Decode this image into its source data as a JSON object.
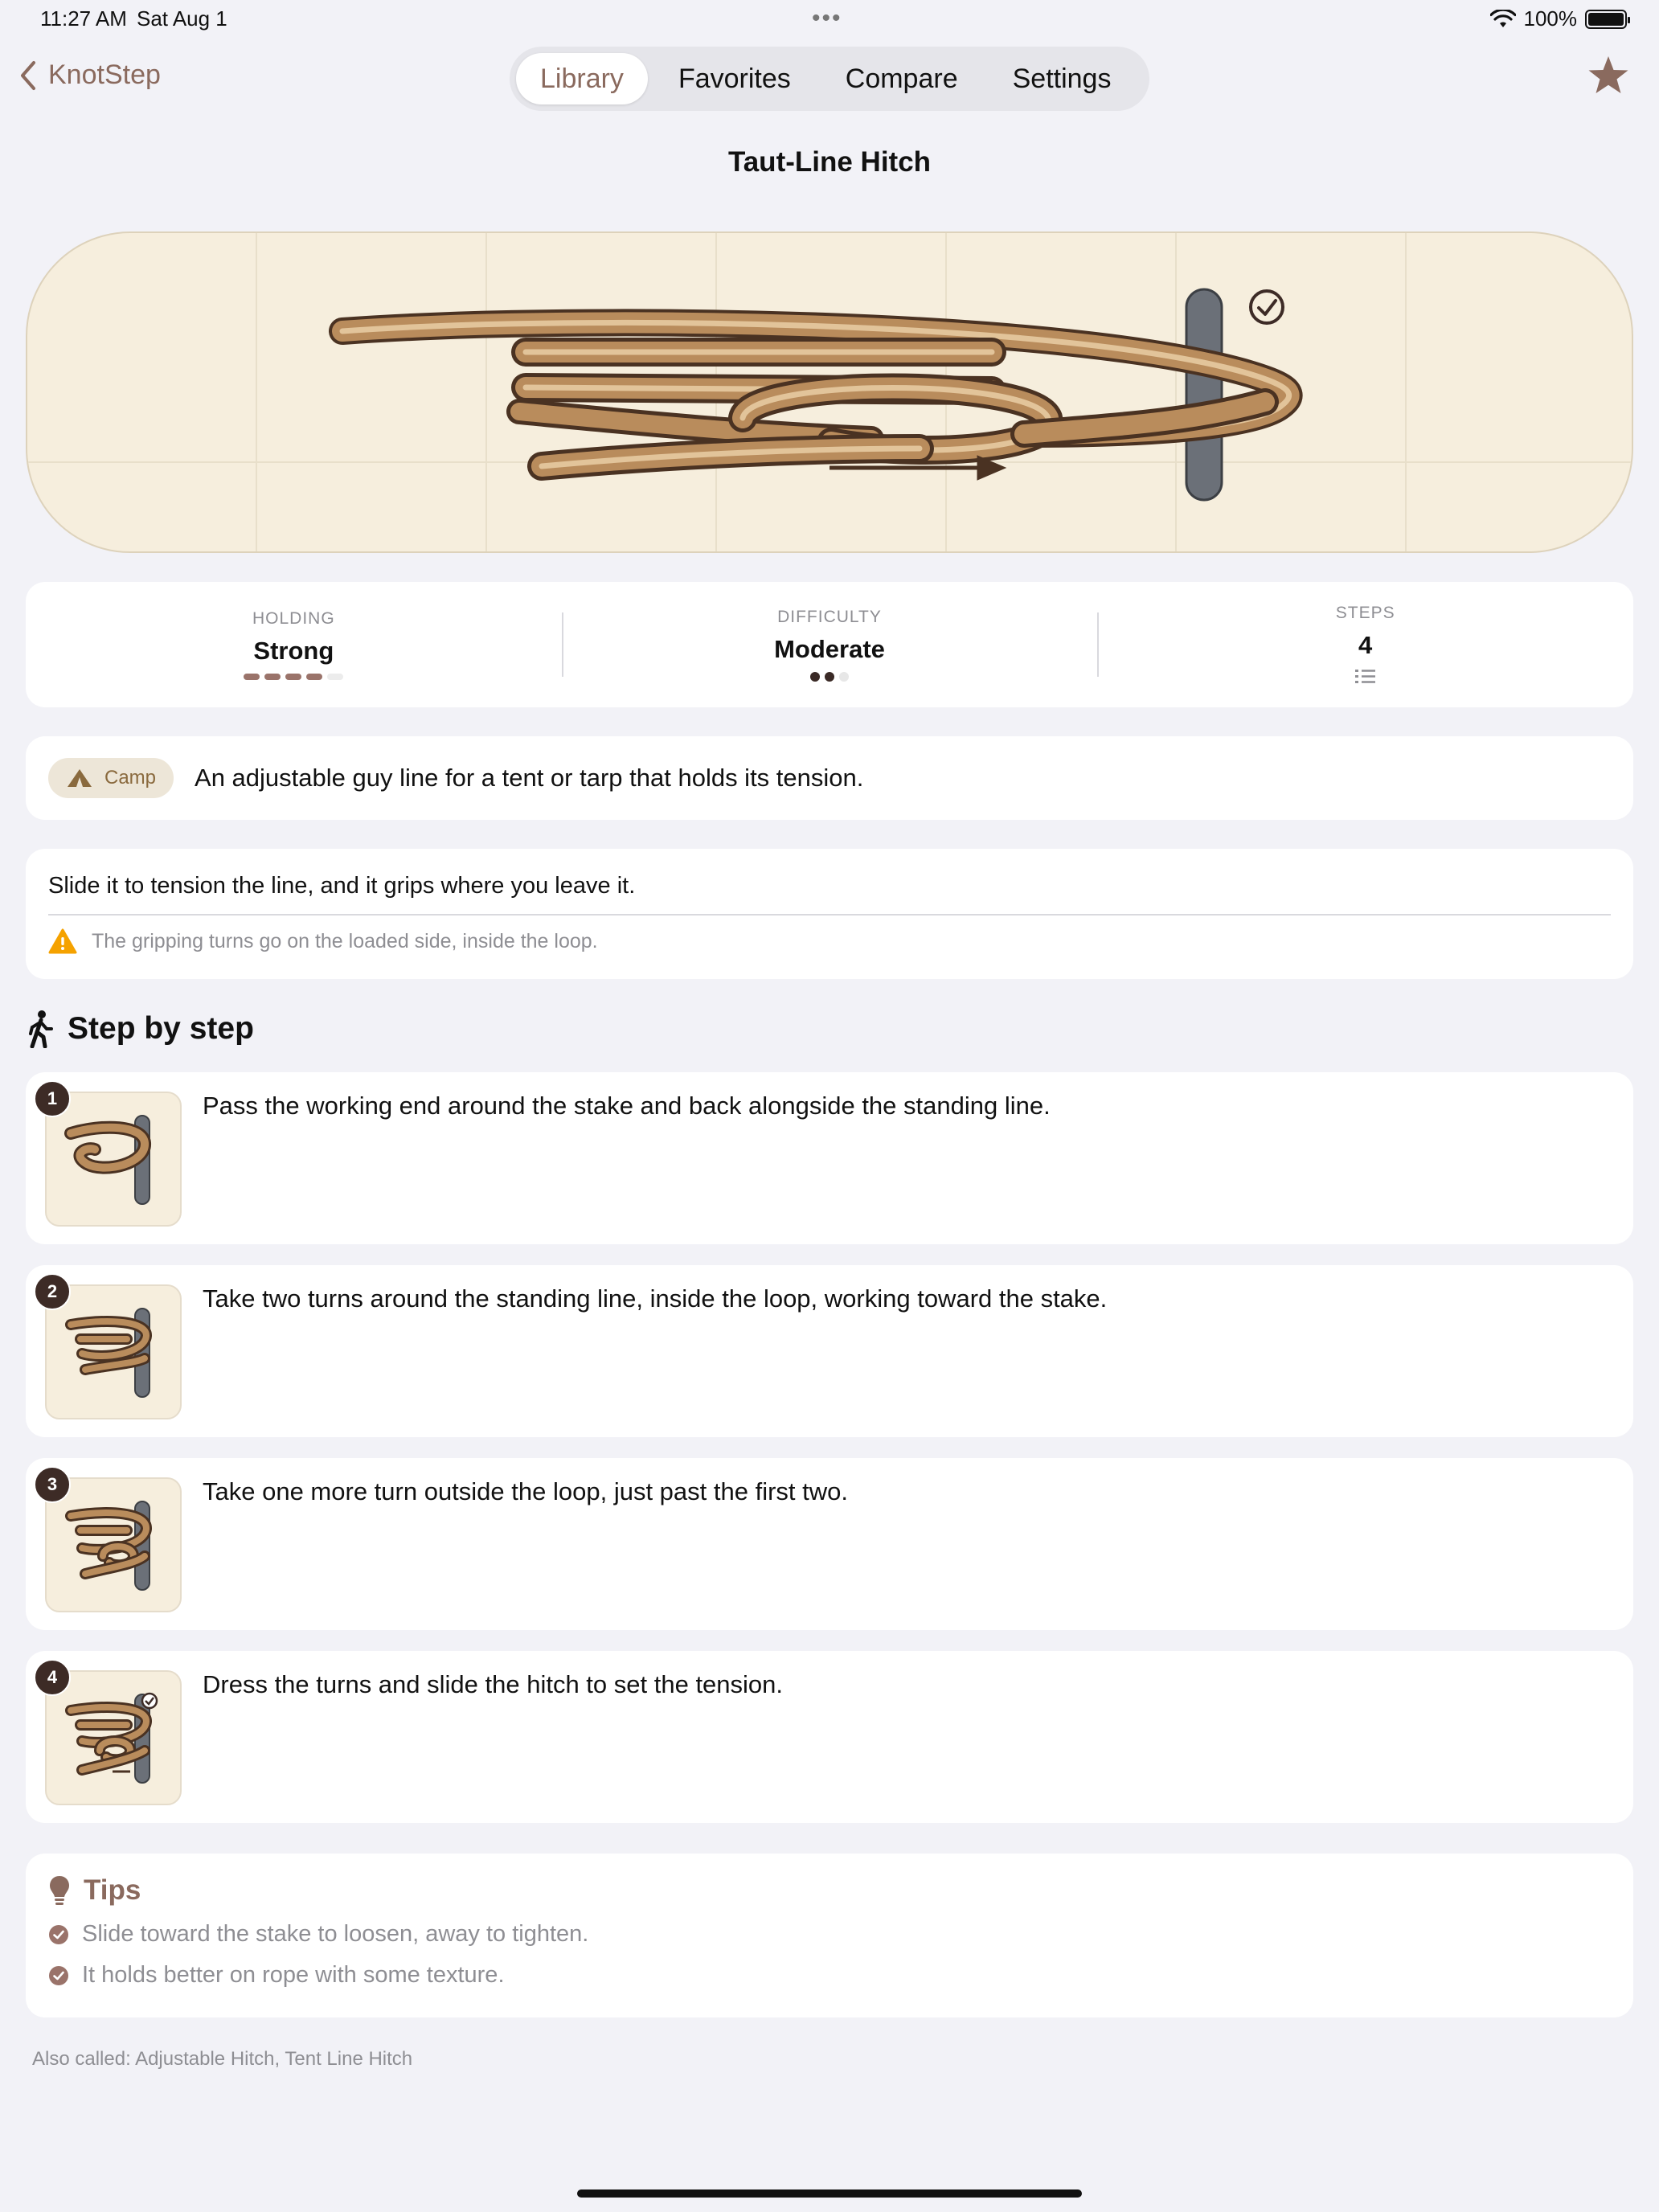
{
  "status_bar": {
    "time": "11:27 AM",
    "date": "Sat Aug 1",
    "battery": "100%"
  },
  "nav": {
    "back_label": "KnotStep",
    "tabs": [
      "Library",
      "Favorites",
      "Compare",
      "Settings"
    ],
    "active_tab": "Library"
  },
  "knot": {
    "title": "Taut-Line Hitch"
  },
  "stats": {
    "holding": {
      "label": "HOLDING",
      "value": "Strong",
      "level": 4,
      "max": 5
    },
    "difficulty": {
      "label": "DIFFICULTY",
      "value": "Moderate",
      "level": 2,
      "max": 3
    },
    "steps": {
      "label": "STEPS",
      "value": "4"
    }
  },
  "summary": {
    "category": "Camp",
    "category_icon": "tent-icon",
    "text": "An adjustable guy line for a tent or tarp that holds its tension."
  },
  "detail": {
    "text": "Slide it to tension the line, and it grips where you leave it.",
    "warning": "The gripping turns go on the loaded side, inside the loop."
  },
  "steps_section": {
    "title": "Step by step",
    "steps": [
      {
        "number": "1",
        "text": "Pass the working end around the stake and back alongside the standing line."
      },
      {
        "number": "2",
        "text": "Take two turns around the standing line, inside the loop, working toward the stake."
      },
      {
        "number": "3",
        "text": "Take one more turn outside the loop, just past the first two."
      },
      {
        "number": "4",
        "text": "Dress the turns and slide the hitch to set the tension."
      }
    ]
  },
  "tips": {
    "title": "Tips",
    "items": [
      "Slide toward the stake to loosen, away to tighten.",
      "It holds better on rope with some texture."
    ]
  },
  "also_called": "Also called: Adjustable Hitch, Tent Line Hitch",
  "colors": {
    "accent": "#8a6a5e",
    "rope": "#b98c5c",
    "rope_light": "#e2c49a",
    "rope_outline": "#4a3222",
    "stake": "#6b7078",
    "hero_bg": "#f6eedd"
  }
}
